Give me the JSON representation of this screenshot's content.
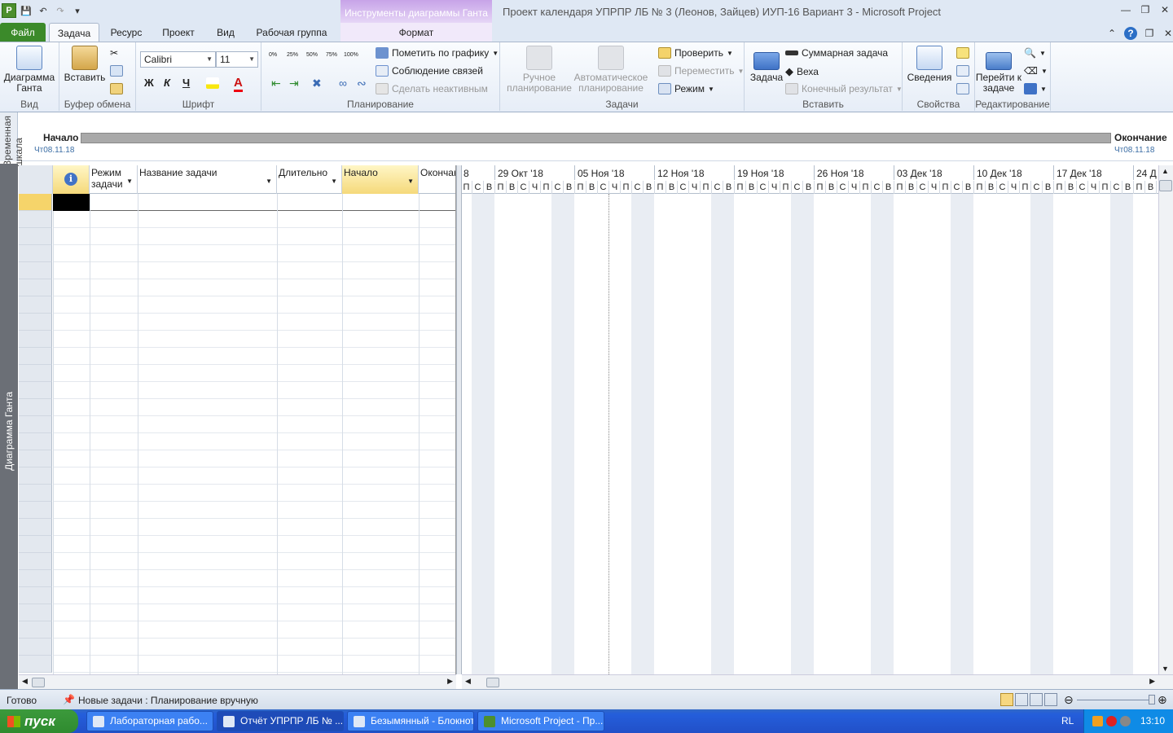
{
  "app": {
    "window_title": "Проект календаря УПРПР ЛБ № 3 (Леонов, Зайцев) ИУП-16 Вариант 3  -  Microsoft Project",
    "contextual_band": "Инструменты диаграммы Ганта"
  },
  "tabs": [
    {
      "label": "Файл"
    },
    {
      "label": "Задача"
    },
    {
      "label": "Ресурс"
    },
    {
      "label": "Проект"
    },
    {
      "label": "Вид"
    },
    {
      "label": "Рабочая группа"
    },
    {
      "label": "Формат"
    }
  ],
  "ribbon": {
    "view": {
      "group": "Вид",
      "gantt_label": "Диаграмма Ганта"
    },
    "clipboard": {
      "group": "Буфер обмена",
      "paste": "Вставить"
    },
    "font": {
      "group": "Шрифт",
      "name": "Calibri",
      "size": "11",
      "bold": "Ж",
      "italic": "К",
      "underline": "Ч",
      "color_letter": "A"
    },
    "schedule": {
      "group": "Планирование",
      "pct": [
        "0%",
        "25%",
        "50%",
        "75%",
        "100%"
      ],
      "mark_on_track": "Пометить по графику",
      "respect_links": "Соблюдение связей",
      "inactivate": "Сделать неактивным"
    },
    "tasks": {
      "group": "Задачи",
      "manual": "Ручное планирование",
      "auto": "Автоматическое планирование",
      "inspect": "Проверить",
      "move": "Переместить",
      "mode": "Режим"
    },
    "insert": {
      "group": "Вставить",
      "task": "Задача",
      "summary": "Суммарная задача",
      "milestone": "Веха",
      "deliverable": "Конечный результат"
    },
    "properties": {
      "group": "Свойства",
      "info": "Сведения"
    },
    "editing": {
      "group": "Редактирование",
      "goto": "Перейти к задаче"
    }
  },
  "timeline": {
    "side_label": "Временная шкала",
    "start_label": "Начало",
    "start_date": "Чт08.11.18",
    "end_label": "Окончание",
    "end_date": "Чт08.11.18"
  },
  "view_bar": {
    "label": "Диаграмма Ганта"
  },
  "grid": {
    "columns": [
      {
        "label": "Режим задачи"
      },
      {
        "label": "Название задачи"
      },
      {
        "label": "Длительно"
      },
      {
        "label": "Начало"
      },
      {
        "label": "Окончан"
      }
    ]
  },
  "gantt": {
    "first_week_fragment": "8",
    "weeks": [
      "29 Окт '18",
      "05 Ноя '18",
      "12 Ноя '18",
      "19 Ноя '18",
      "26 Ноя '18",
      "03 Дек '18",
      "10 Дек '18",
      "17 Дек '18",
      "24 Д"
    ],
    "day_letters": [
      "П",
      "В",
      "С",
      "Ч",
      "П",
      "С",
      "В"
    ]
  },
  "status": {
    "ready": "Готово",
    "new_tasks": "Новые задачи : Планирование вручную"
  },
  "taskbar": {
    "start": "пуск",
    "items": [
      {
        "label": "Лабораторная рабо..."
      },
      {
        "label": "Отчёт УПРПР ЛБ № ..."
      },
      {
        "label": "Безымянный - Блокнот"
      },
      {
        "label": "Microsoft Project - Пр..."
      }
    ],
    "lang": "RL",
    "clock": "13:10"
  }
}
